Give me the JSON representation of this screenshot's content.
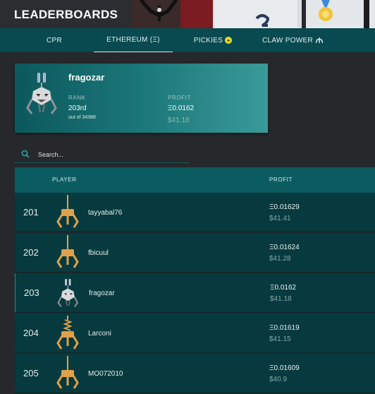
{
  "header": {
    "title": "LEADERBOARDS"
  },
  "tabs": [
    {
      "label": "CPR",
      "icon": ""
    },
    {
      "label": "ETHEREUM (Ξ)",
      "icon": ""
    },
    {
      "label": "PICKIES",
      "icon": "coin-icon"
    },
    {
      "label": "CLAW POWER",
      "icon": "claw-power-icon"
    }
  ],
  "active_tab": "ETHEREUM (Ξ)",
  "current_player": {
    "name": "fragozar",
    "rank_label": "RANK",
    "rank": "203rd",
    "rank_total": "out of 34388",
    "profit_label": "PROFIT",
    "profit_eth": "Ξ0.0162",
    "profit_usd": "$41.18"
  },
  "search": {
    "placeholder": "Search..."
  },
  "table": {
    "columns": {
      "player": "PLAYER",
      "profit": "PROFIT"
    },
    "rows": [
      {
        "rank": "201",
        "name": "tayyabal76",
        "eth": "Ξ0.01629",
        "usd": "$41.41",
        "avatar": "claw-avatar-icon"
      },
      {
        "rank": "202",
        "name": "fbicuul",
        "eth": "Ξ0.01624",
        "usd": "$41.28",
        "avatar": "claw-avatar-icon"
      },
      {
        "rank": "203",
        "name": "fragozar",
        "eth": "Ξ0.0162",
        "usd": "$41.18",
        "avatar": "robot-avatar-icon"
      },
      {
        "rank": "204",
        "name": "Larconi",
        "eth": "Ξ0.01619",
        "usd": "$41.15",
        "avatar": "claw-spring-avatar-icon"
      },
      {
        "rank": "205",
        "name": "MO072010",
        "eth": "Ξ0.01609",
        "usd": "$40.9",
        "avatar": "claw-avatar-icon"
      }
    ]
  },
  "colors": {
    "background": "#26282b",
    "tab_bar": "#084a50",
    "row_bg": "#063a3e",
    "card_gradient_start": "#0c585c",
    "card_gradient_end": "#3a9a9a",
    "claw_gold": "#e0a14a"
  }
}
